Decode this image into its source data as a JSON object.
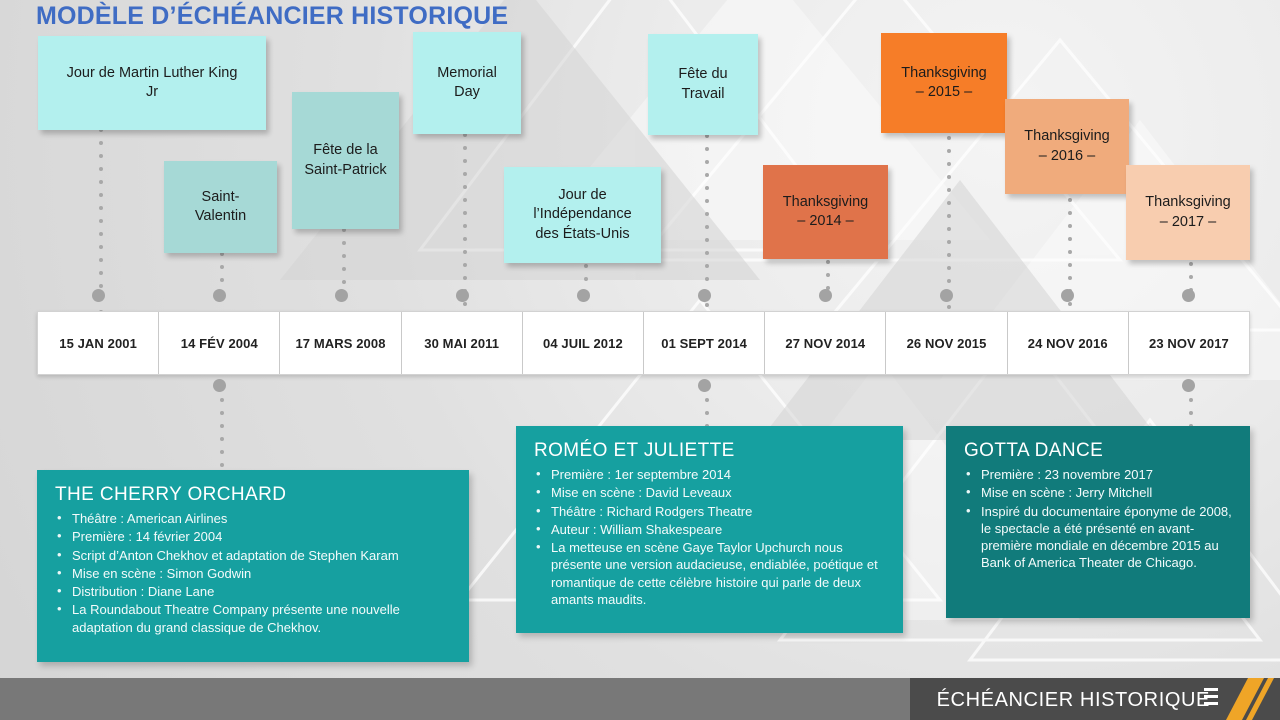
{
  "title": "MODÈLE D’ÉCHÉANCIER HISTORIQUE",
  "colors": {
    "title": "#3f6cc4",
    "card_cyan": "#b3f0ee",
    "card_teal": "#a6d9d6",
    "thanksgiving_2014": "#e0734a",
    "thanksgiving_2015": "#f67d28",
    "thanksgiving_2016": "#f0ab7c",
    "thanksgiving_2017": "#f8cdaf",
    "panel": "#16a0a0",
    "footer": "#4b4b4b",
    "footer_accent": "#efa527"
  },
  "events": [
    {
      "label": "Jour de Martin Luther King Jr",
      "row": "front",
      "color": "#b3f0ee"
    },
    {
      "label": "Saint-Valentin",
      "row": "back",
      "color": "#a6d9d6"
    },
    {
      "label": "Fête de la Saint-Patrick",
      "row": "back",
      "color": "#a6d9d6"
    },
    {
      "label": "Memorial Day",
      "row": "front",
      "color": "#b3f0ee"
    },
    {
      "label": "Jour de l’Indépendance des États-Unis",
      "row": "back",
      "color": "#b3f0ee"
    },
    {
      "label": "Fête du Travail",
      "row": "front",
      "color": "#b3f0ee"
    },
    {
      "label": "Thanksgiving – 2014 –",
      "row": "back",
      "color": "#e0734a"
    },
    {
      "label": "Thanksgiving – 2015 –",
      "row": "front",
      "color": "#f67d28"
    },
    {
      "label": "Thanksgiving – 2016 –",
      "row": "back",
      "color": "#f0ab7c"
    },
    {
      "label": "Thanksgiving – 2017 –",
      "row": "back",
      "color": "#f8cdaf"
    }
  ],
  "event_lines": {
    "e0": [
      "Jour de Martin Luther King",
      "Jr"
    ],
    "e1": [
      "Saint-",
      "Valentin"
    ],
    "e2": [
      "Fête de la",
      "Saint-Patrick"
    ],
    "e3": [
      "Memorial",
      "Day"
    ],
    "e4": [
      "Jour de",
      "l’Indépendance",
      "des États-Unis"
    ],
    "e5": [
      "Fête du",
      "Travail"
    ],
    "e6": [
      "Thanksgiving",
      "– 2014 –"
    ],
    "e7": [
      "Thanksgiving",
      "– 2015 –"
    ],
    "e8": [
      "Thanksgiving",
      "– 2016 –"
    ],
    "e9": [
      "Thanksgiving",
      "– 2017 –"
    ]
  },
  "dates": [
    "15 JAN 2001",
    "14 FÉV 2004",
    "17 MARS 2008",
    "30 MAI 2011",
    "04 JUIL 2012",
    "01 SEPT 2014",
    "27 NOV 2014",
    "26 NOV 2015",
    "24 NOV 2016",
    "23 NOV 2017"
  ],
  "panels": [
    {
      "heading": "THE CHERRY ORCHARD",
      "bullets": [
        "Théâtre : American Airlines",
        "Première : 14 février 2004",
        "Script d’Anton Chekhov et adaptation de Stephen Karam",
        "Mise en scène : Simon Godwin",
        "Distribution : Diane Lane",
        "La Roundabout Theatre Company présente une nouvelle adaptation du grand classique de Chekhov."
      ]
    },
    {
      "heading": "ROMÉO ET JULIETTE",
      "bullets": [
        "Première : 1er septembre 2014",
        "Mise en scène : David Leveaux",
        "Théâtre : Richard Rodgers Theatre",
        "Auteur : William Shakespeare",
        "La metteuse en scène Gaye Taylor Upchurch nous présente une version audacieuse, endiablée, poétique et romantique de cette célèbre histoire qui parle de deux amants maudits."
      ]
    },
    {
      "heading": "GOTTA DANCE",
      "bullets": [
        "Première : 23 novembre 2017",
        "Mise en scène : Jerry Mitchell",
        "Inspiré du documentaire éponyme de 2008, le spectacle a été présenté en avant-première mondiale en décembre 2015 au Bank of America Theater de Chicago."
      ]
    }
  ],
  "footer": {
    "title": "ÉCHÉANCIER HISTORIQUE"
  }
}
